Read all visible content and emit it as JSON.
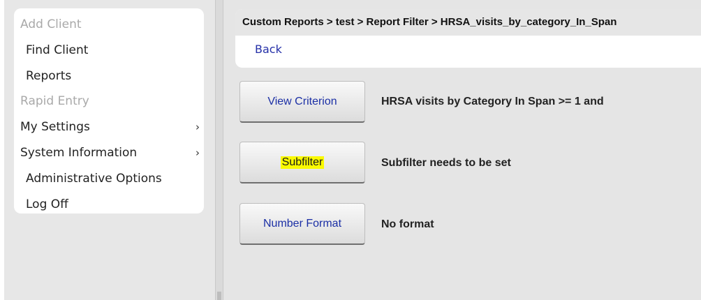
{
  "sidebar": {
    "items": [
      {
        "label": "Add Client",
        "disabled": true
      },
      {
        "label": "Find Client"
      },
      {
        "label": "Reports"
      },
      {
        "label": "Rapid Entry",
        "disabled": true
      },
      {
        "label": "My Settings",
        "chevron": "›"
      },
      {
        "label": "System Information",
        "chevron": "›"
      },
      {
        "label": "Administrative Options"
      },
      {
        "label": "Log Off"
      }
    ]
  },
  "header": {
    "breadcrumb": "Custom Reports > test > Report Filter > HRSA_visits_by_category_In_Span",
    "back_label": "Back"
  },
  "options": [
    {
      "button": "View Criterion",
      "description": "HRSA visits by Category In Span >= 1 and"
    },
    {
      "button": "Subfilter",
      "description": "Subfilter needs to be set",
      "highlight_color": "#fafa00"
    },
    {
      "button": "Number Format",
      "description": "No format"
    }
  ],
  "colors": {
    "link": "#2530a8",
    "button_text": "#1b2fa5",
    "disabled_text": "#a9a9a9",
    "highlight": "#fafa00"
  }
}
